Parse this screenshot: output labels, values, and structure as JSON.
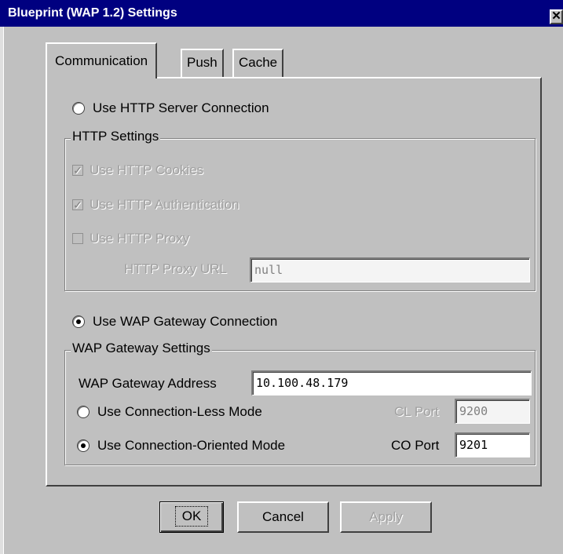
{
  "window": {
    "title": "Blueprint (WAP 1.2) Settings",
    "close_glyph": "✕"
  },
  "tabs": [
    {
      "label": "Communication",
      "active": true
    },
    {
      "label": "Push",
      "active": false
    },
    {
      "label": "Cache",
      "active": false
    }
  ],
  "http": {
    "radio_label": "Use HTTP Server Connection",
    "radio_selected": false,
    "group_label": "HTTP Settings",
    "cookies_label": "Use HTTP Cookies",
    "cookies_checked": true,
    "auth_label": "Use HTTP Authentication",
    "auth_checked": true,
    "proxy_label": "Use HTTP Proxy",
    "proxy_checked": false,
    "proxy_url_label": "HTTP Proxy URL",
    "proxy_url_value": "null"
  },
  "wap": {
    "radio_label": "Use WAP Gateway Connection",
    "radio_selected": true,
    "group_label": "WAP Gateway Settings",
    "address_label": "WAP Gateway Address",
    "address_value": "10.100.48.179",
    "cl_mode_label": "Use Connection-Less Mode",
    "cl_mode_selected": false,
    "cl_port_label": "CL Port",
    "cl_port_value": "9200",
    "co_mode_label": "Use Connection-Oriented Mode",
    "co_mode_selected": true,
    "co_port_label": "CO Port",
    "co_port_value": "9201"
  },
  "buttons": {
    "ok": "OK",
    "cancel": "Cancel",
    "apply": "Apply"
  },
  "icons": {
    "check_mark": "✓"
  }
}
